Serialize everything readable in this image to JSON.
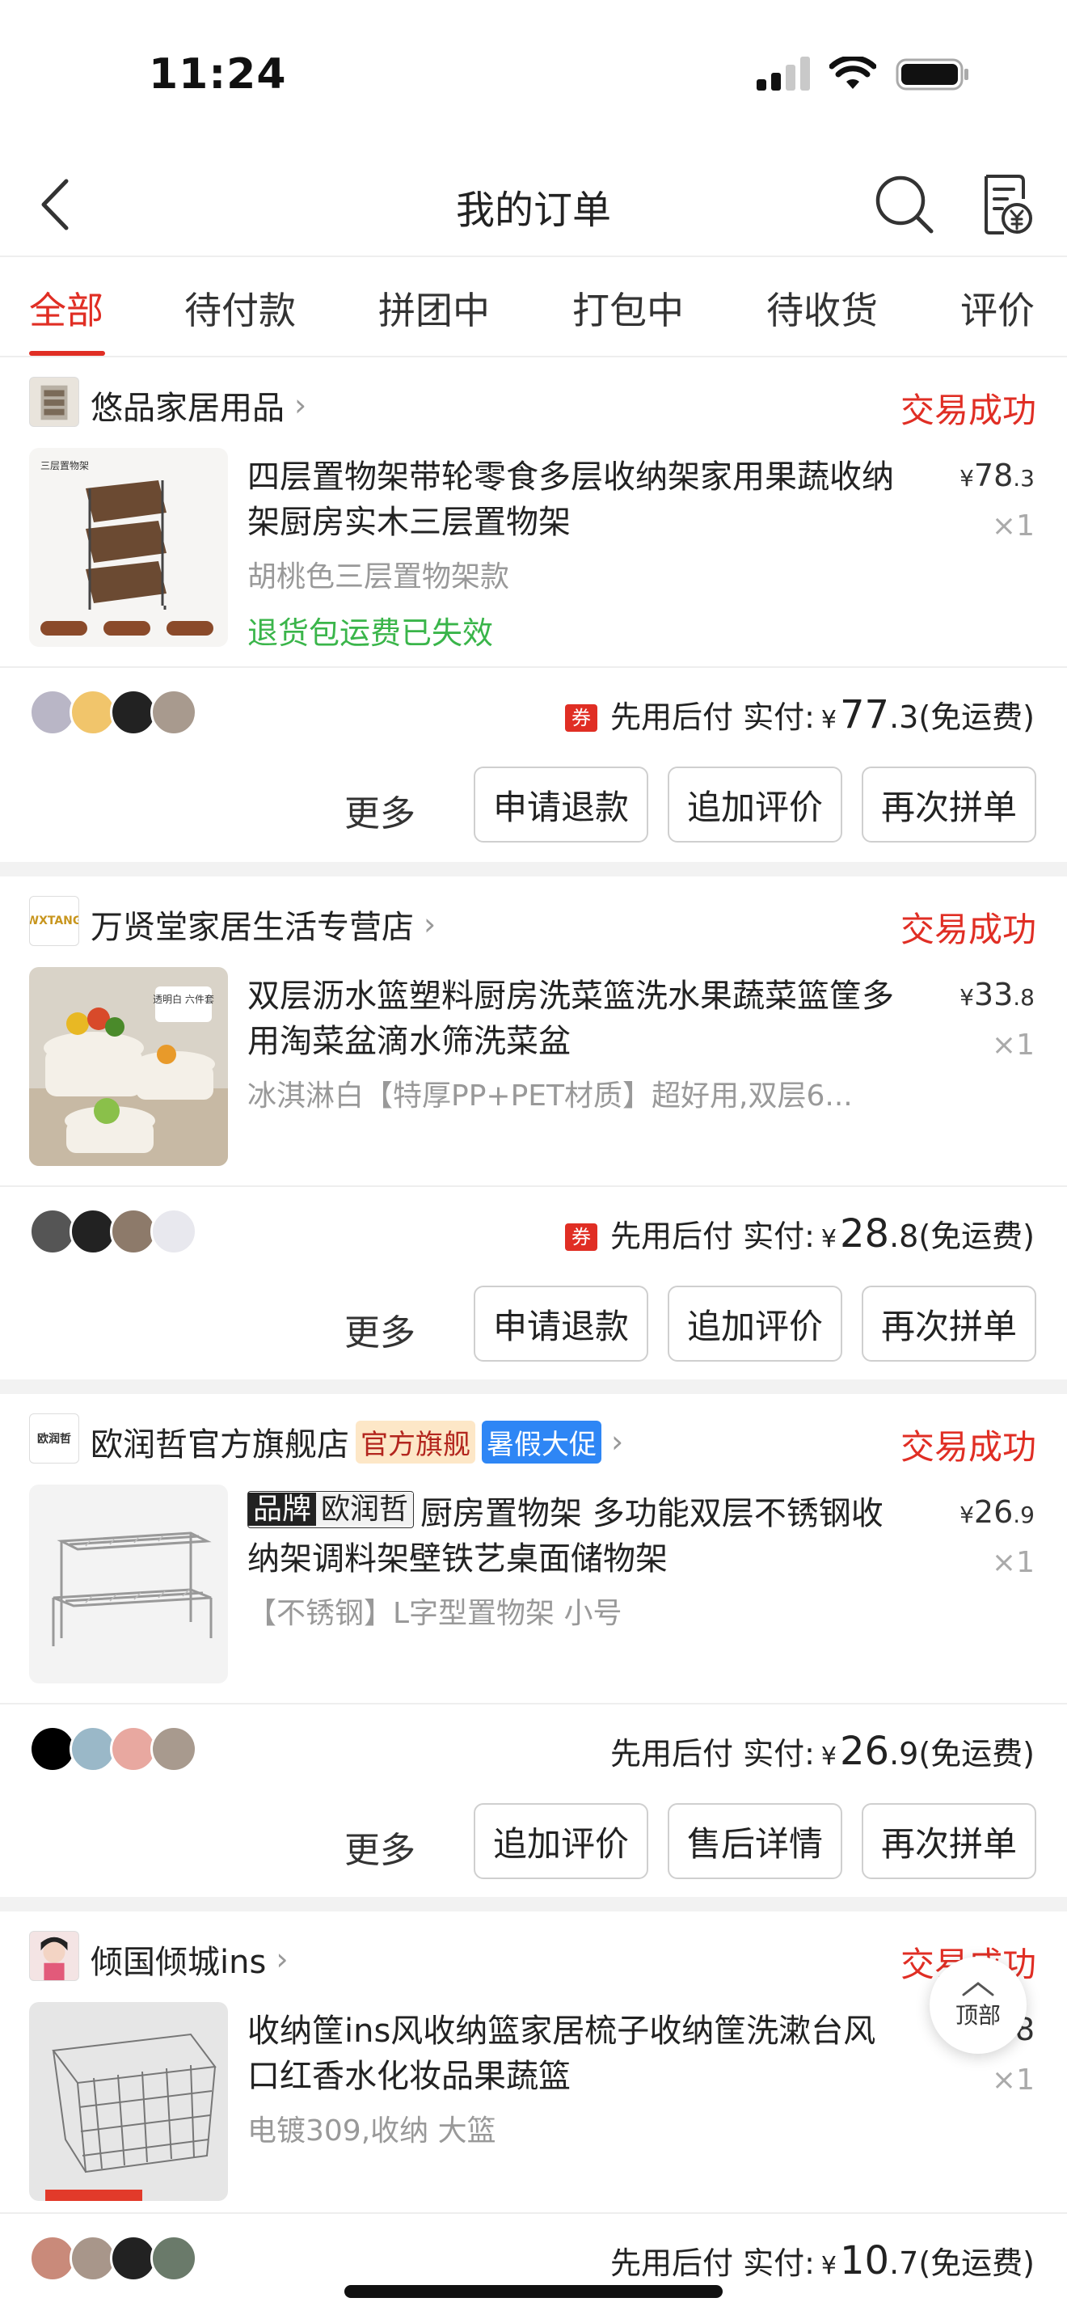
{
  "status_bar": {
    "time": "11:24"
  },
  "header": {
    "title": "我的订单"
  },
  "tabs": [
    {
      "label": "全部",
      "active": true
    },
    {
      "label": "待付款"
    },
    {
      "label": "拼团中"
    },
    {
      "label": "打包中"
    },
    {
      "label": "待收货"
    },
    {
      "label": "评价"
    }
  ],
  "orders": [
    {
      "store": "悠品家居用品",
      "status": "交易成功",
      "product_title": "四层置物架带轮零食多层收纳架家用果蔬收纳架厨房实木三层置物架",
      "variant": "胡桃色三层置物架款",
      "note": "退货包运费已失效",
      "price_int": "78",
      "price_dec": ".3",
      "qty": "×1",
      "thumb_label": "三层置物架",
      "coupon": "券",
      "pay_label": "先用后付 实付:",
      "paid_int": "77",
      "paid_dec": ".3",
      "shipping": "(免运费)",
      "more": "更多",
      "buttons": [
        "申请退款",
        "追加评价",
        "再次拼单"
      ]
    },
    {
      "store": "万贤堂家居生活专营店",
      "status": "交易成功",
      "logo_text": "WXTANG",
      "product_title": "双层沥水篮塑料厨房洗菜篮洗水果蔬菜篮筐多用淘菜盆滴水筛洗菜盆",
      "variant": "冰淇淋白【特厚PP+PET材质】超好用,双层6...",
      "price_int": "33",
      "price_dec": ".8",
      "qty": "×1",
      "thumb_label": "透明白 六件套",
      "coupon": "券",
      "pay_label": "先用后付 实付:",
      "paid_int": "28",
      "paid_dec": ".8",
      "shipping": "(免运费)",
      "more": "更多",
      "buttons": [
        "申请退款",
        "追加评价",
        "再次拼单"
      ]
    },
    {
      "store": "欧润哲官方旗舰店",
      "status": "交易成功",
      "logo_text": "欧润哲",
      "tag_official": "官方旗舰",
      "tag_promo": "暑假大促",
      "brand_chip_1": "品牌",
      "brand_chip_2": "欧润哲",
      "product_title": "厨房置物架 多功能双层不锈钢收纳架调料架壁铁艺桌面储物架",
      "variant": "【不锈钢】L字型置物架 小号",
      "price_int": "26",
      "price_dec": ".9",
      "qty": "×1",
      "pay_label": "先用后付 实付:",
      "paid_int": "26",
      "paid_dec": ".9",
      "shipping": "(免运费)",
      "more": "更多",
      "buttons": [
        "追加评价",
        "售后详情",
        "再次拼单"
      ]
    },
    {
      "store": "倾国倾城ins",
      "status": "交易成功",
      "product_title": "收纳筐ins风收纳篮家居梳子收纳筐洗漱台风口红香水化妆品果蔬篮",
      "variant": "电镀309,收纳 大篮",
      "price_int": "",
      "price_dec": "8",
      "qty": "×1",
      "pay_label": "先用后付 实付:",
      "paid_int": "10",
      "paid_dec": ".7",
      "shipping": "(免运费)"
    }
  ],
  "currency": "¥",
  "top_button": {
    "label": "顶部"
  }
}
